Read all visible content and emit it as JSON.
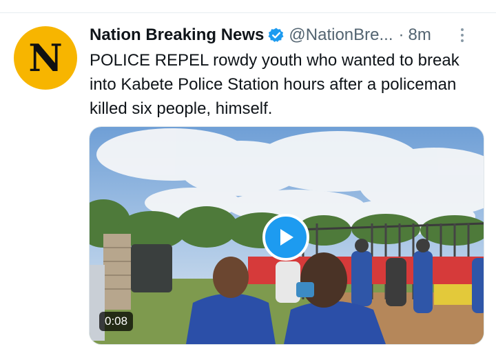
{
  "colors": {
    "avatar_bg": "#f7b500",
    "verified_blue": "#1d9bf0",
    "text_primary": "#0f1419",
    "text_secondary": "#536471",
    "play_button": "#1d9bf0"
  },
  "tweet": {
    "avatar_letter": "N",
    "display_name": "Nation Breaking News",
    "verified_icon": "verified-badge-icon",
    "handle": "@NationBre...",
    "separator": "·",
    "time": "8m",
    "more_icon": "more-vertical-icon",
    "text": "POLICE REPEL rowdy youth who wanted to break into Kabete Police Station hours after a policeman killed six people, himself.",
    "media": {
      "type": "video",
      "play_icon": "play-icon",
      "duration": "0:08"
    }
  }
}
